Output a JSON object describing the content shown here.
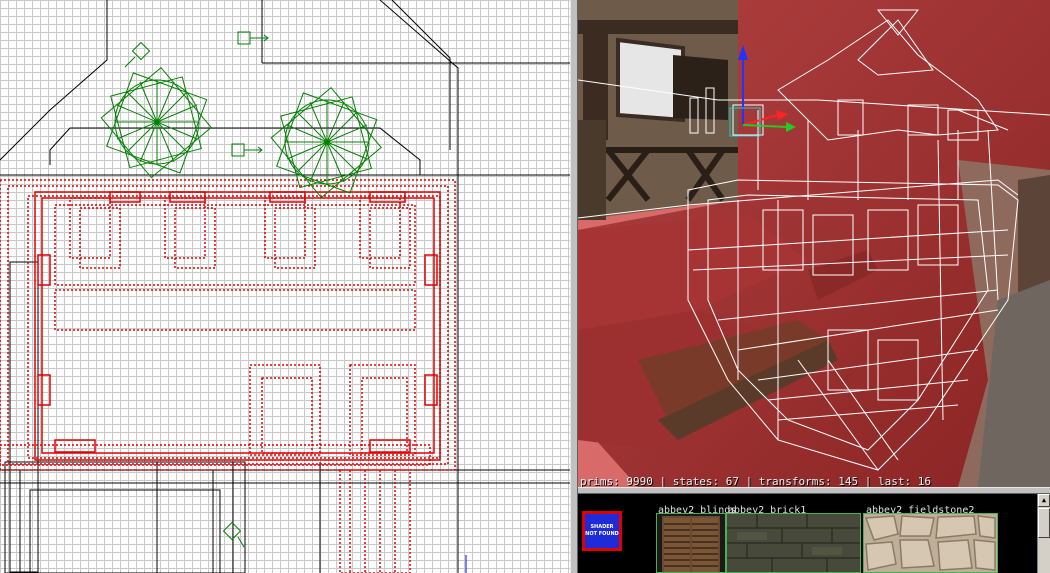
{
  "camera": {
    "stats": "prims: 9990 | states: 67 | transforms: 145 | last: 16"
  },
  "texture_browser": {
    "missing_shader": "SHADER NOT FOUND",
    "textures": [
      {
        "name": "abbey2_blinds"
      },
      {
        "name": "abbey2_brick1"
      },
      {
        "name": "abbey2_fieldstone2"
      }
    ]
  },
  "colors": {
    "brush_selected": "#e00000",
    "entity": "#008000",
    "grid_minor": "#c8c8c8",
    "grid_major": "#000000",
    "selection_border": "#4caf50"
  }
}
